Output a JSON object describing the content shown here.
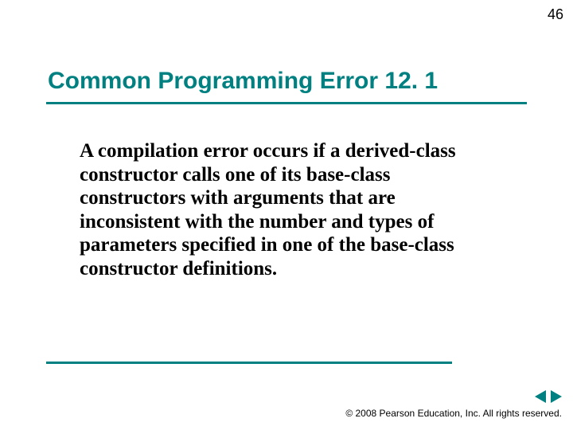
{
  "pageNumber": "46",
  "title": "Common Programming Error 12. 1",
  "body": "A compilation error occurs if a derived-class constructor calls one of its base-class constructors with arguments that are inconsistent with the number and types of parameters specified in one of the base-class constructor definitions.",
  "copyright": "© 2008 Pearson Education, Inc.  All rights reserved."
}
